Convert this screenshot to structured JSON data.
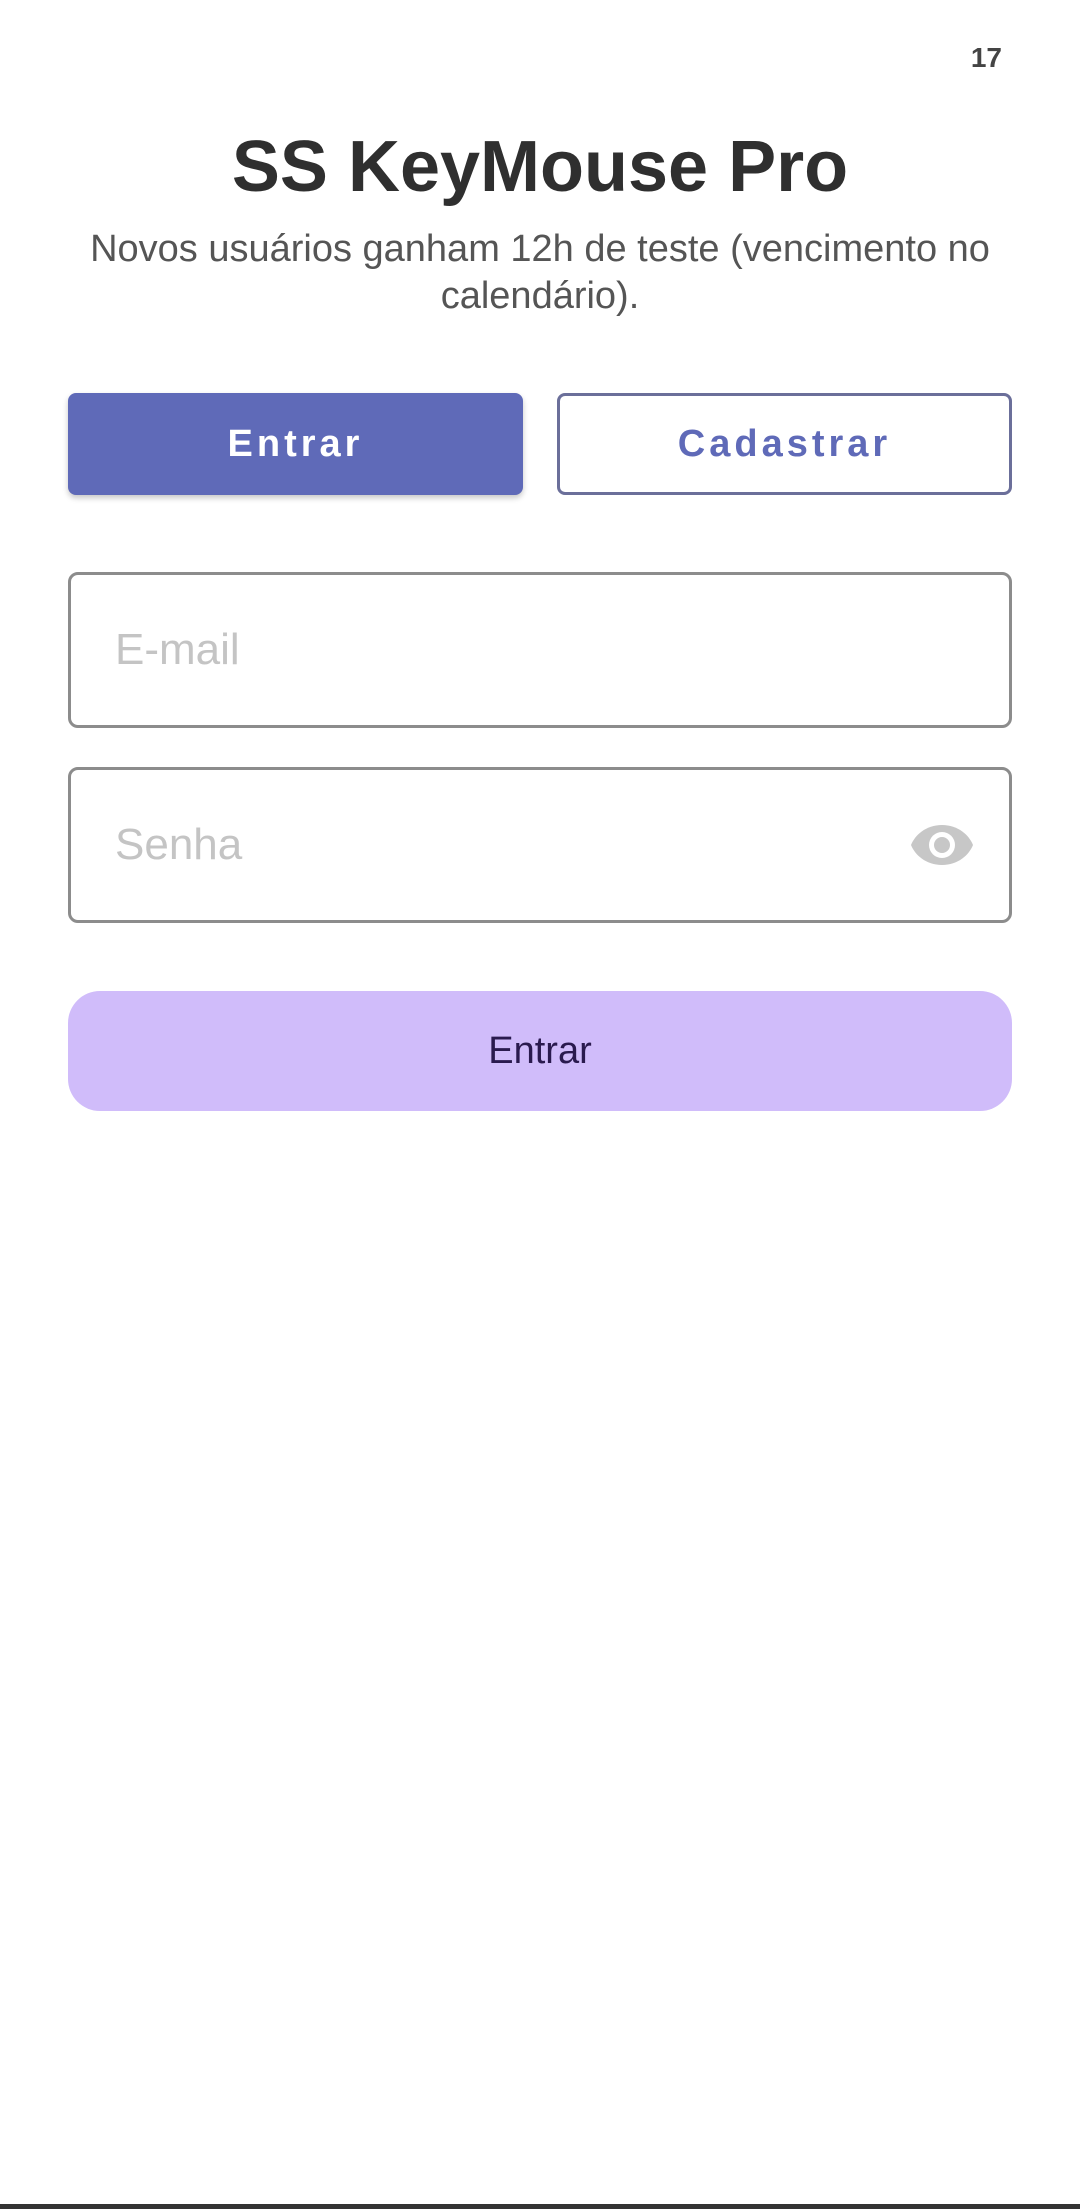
{
  "status": {
    "counter": "17"
  },
  "header": {
    "title": "SS KeyMouse Pro",
    "subtitle": "Novos usuários ganham 12h de teste (vencimento no calendário)."
  },
  "tabs": {
    "login_label": "Entrar",
    "register_label": "Cadastrar",
    "active": "login"
  },
  "form": {
    "email": {
      "value": "",
      "placeholder": "E-mail"
    },
    "password": {
      "value": "",
      "placeholder": "Senha",
      "toggle_icon": "eye-icon"
    },
    "submit_label": "Entrar"
  },
  "colors": {
    "primary": "#5f6ab8",
    "submit_bg": "#d0bcfa",
    "submit_text": "#2a1a4e"
  }
}
